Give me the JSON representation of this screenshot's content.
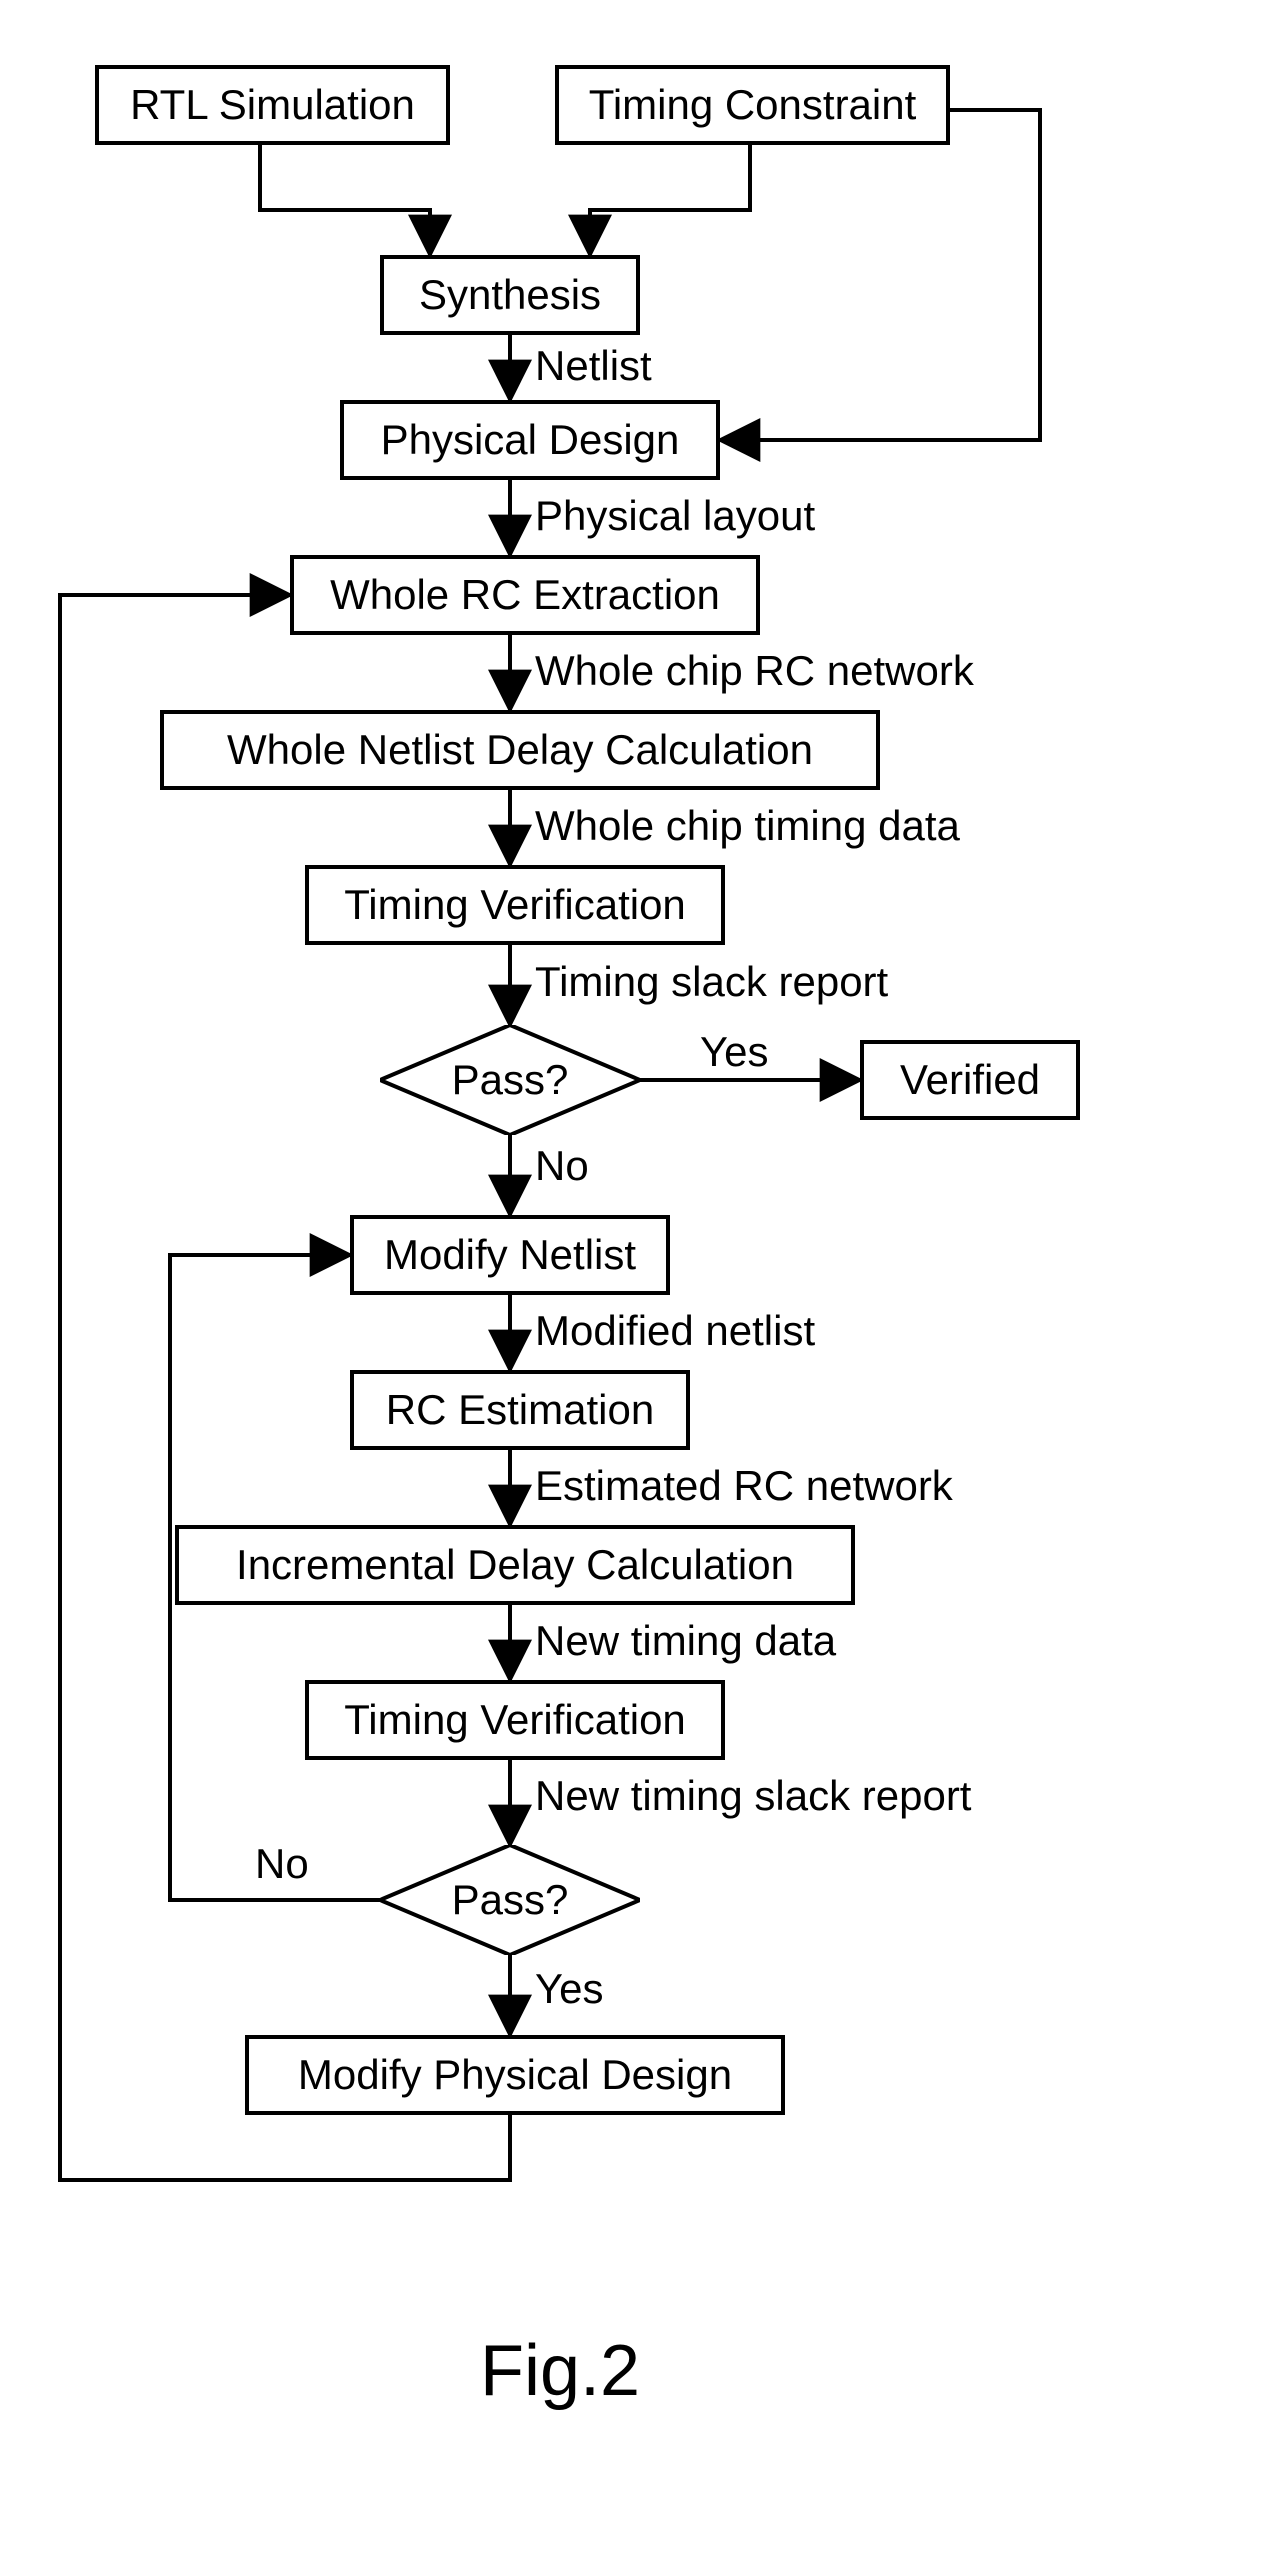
{
  "nodes": {
    "rtl": "RTL Simulation",
    "tc": "Timing Constraint",
    "synth": "Synthesis",
    "pd": "Physical Design",
    "wre": "Whole RC Extraction",
    "wndc": "Whole Netlist Delay Calculation",
    "tv1": "Timing Verification",
    "pass1": "Pass?",
    "verified": "Verified",
    "mn": "Modify Netlist",
    "rce": "RC Estimation",
    "idc": "Incremental Delay Calculation",
    "tv2": "Timing Verification",
    "pass2": "Pass?",
    "mpd": "Modify Physical Design"
  },
  "edges": {
    "netlist": "Netlist",
    "phys_layout": "Physical layout",
    "whole_rc_net": "Whole chip RC network",
    "whole_timing": "Whole chip timing data",
    "slack1": "Timing slack report",
    "yes1": "Yes",
    "no1": "No",
    "mod_netlist": "Modified netlist",
    "est_rc": "Estimated RC network",
    "new_timing": "New timing data",
    "slack2": "New timing slack report",
    "yes2": "Yes",
    "no2": "No"
  },
  "figure": "Fig.2",
  "chart_data": {
    "type": "flowchart",
    "title": "Fig.2",
    "nodes": [
      {
        "id": "rtl",
        "label": "RTL Simulation",
        "shape": "rect"
      },
      {
        "id": "tc",
        "label": "Timing Constraint",
        "shape": "rect"
      },
      {
        "id": "synth",
        "label": "Synthesis",
        "shape": "rect"
      },
      {
        "id": "pd",
        "label": "Physical Design",
        "shape": "rect"
      },
      {
        "id": "wre",
        "label": "Whole RC Extraction",
        "shape": "rect"
      },
      {
        "id": "wndc",
        "label": "Whole Netlist Delay Calculation",
        "shape": "rect"
      },
      {
        "id": "tv1",
        "label": "Timing Verification",
        "shape": "rect"
      },
      {
        "id": "pass1",
        "label": "Pass?",
        "shape": "diamond"
      },
      {
        "id": "verified",
        "label": "Verified",
        "shape": "rect"
      },
      {
        "id": "mn",
        "label": "Modify Netlist",
        "shape": "rect"
      },
      {
        "id": "rce",
        "label": "RC Estimation",
        "shape": "rect"
      },
      {
        "id": "idc",
        "label": "Incremental Delay Calculation",
        "shape": "rect"
      },
      {
        "id": "tv2",
        "label": "Timing Verification",
        "shape": "rect"
      },
      {
        "id": "pass2",
        "label": "Pass?",
        "shape": "diamond"
      },
      {
        "id": "mpd",
        "label": "Modify Physical Design",
        "shape": "rect"
      }
    ],
    "edges": [
      {
        "from": "rtl",
        "to": "synth"
      },
      {
        "from": "tc",
        "to": "synth"
      },
      {
        "from": "tc",
        "to": "pd"
      },
      {
        "from": "synth",
        "to": "pd",
        "label": "Netlist"
      },
      {
        "from": "pd",
        "to": "wre",
        "label": "Physical layout"
      },
      {
        "from": "wre",
        "to": "wndc",
        "label": "Whole chip RC network"
      },
      {
        "from": "wndc",
        "to": "tv1",
        "label": "Whole chip timing data"
      },
      {
        "from": "tv1",
        "to": "pass1",
        "label": "Timing slack report"
      },
      {
        "from": "pass1",
        "to": "verified",
        "label": "Yes"
      },
      {
        "from": "pass1",
        "to": "mn",
        "label": "No"
      },
      {
        "from": "mn",
        "to": "rce",
        "label": "Modified netlist"
      },
      {
        "from": "rce",
        "to": "idc",
        "label": "Estimated RC network"
      },
      {
        "from": "idc",
        "to": "tv2",
        "label": "New timing data"
      },
      {
        "from": "tv2",
        "to": "pass2",
        "label": "New timing slack report"
      },
      {
        "from": "pass2",
        "to": "mpd",
        "label": "Yes"
      },
      {
        "from": "pass2",
        "to": "mn",
        "label": "No"
      },
      {
        "from": "mpd",
        "to": "wre"
      }
    ]
  }
}
